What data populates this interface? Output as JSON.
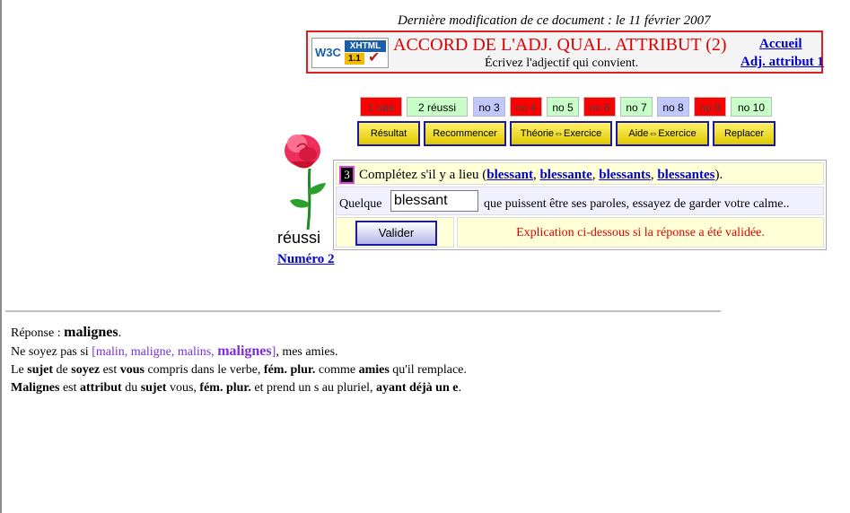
{
  "last_modified": "Dernière modification de ce document : le 11 février 2007",
  "header": {
    "badge": {
      "w3c": "W3C",
      "xhtml": "XHTML",
      "version": "1.1"
    },
    "title": "ACCORD DE L'ADJ. QUAL. ATTRIBUT (2)",
    "subtitle": "Écrivez l'adjectif qui convient.",
    "link_home": "Accueil",
    "link_prev": "Adj. attribut 1"
  },
  "number_buttons": [
    {
      "label": "1 raté",
      "state": "rate"
    },
    {
      "label": "2 réussi",
      "state": "reussi"
    },
    {
      "label": "no 3",
      "state": "cur"
    },
    {
      "label": "no 4",
      "state": "rate"
    },
    {
      "label": "no 5",
      "state": "todo"
    },
    {
      "label": "no 6",
      "state": "rate"
    },
    {
      "label": "no 7",
      "state": "todo"
    },
    {
      "label": "no 8",
      "state": "cur"
    },
    {
      "label": "no 9",
      "state": "rate"
    },
    {
      "label": "no 10",
      "state": "todo"
    }
  ],
  "action_buttons": {
    "resultat": "Résultat",
    "recommencer": "Recommencer",
    "theorie": "Théorie⇔Exercice",
    "aide": "Aide⇔Exercice",
    "replacer": "Replacer"
  },
  "status": {
    "label": "réussi",
    "numero": "Numéro 2"
  },
  "exercise": {
    "number": "3",
    "instruction_prefix": "Complétez s'il y a lieu (",
    "options": [
      "blessant",
      "blessante",
      "blessants",
      "blessantes"
    ],
    "sep": ", ",
    "instruction_suffix": ").",
    "sentence_start": "Quelque",
    "answer_value": "blessant",
    "sentence_end": "que puissent être ses paroles, essayez de garder votre calme..",
    "validate_label": "Valider",
    "explanation_note": "Explication ci-dessous si la réponse a été validée."
  },
  "explanation": {
    "line1_prefix": "Réponse : ",
    "line1_answer": "malignes",
    "line1_end": ".",
    "line2_prefix": "Ne soyez pas si ",
    "line2_opts": "[malin, maligne, malins, ",
    "line2_bold": "malignes",
    "line2_close": "]",
    "line2_end": ", mes amies.",
    "line3": {
      "a": "Le ",
      "b": "sujet",
      "c": " de ",
      "d": "soyez",
      "e": " est ",
      "f": "vous",
      "g": " compris dans le verbe, ",
      "h": "fém. plur.",
      "i": " comme ",
      "j": "amies",
      "k": " qu'il remplace."
    },
    "line4": {
      "a": "Malignes",
      "b": " est ",
      "c": "attribut",
      "d": " du ",
      "e": "sujet",
      "f": " vous, ",
      "g": "fém. plur.",
      "h": " et prend un s au pluriel, ",
      "i": "ayant déjà un e",
      "j": "."
    }
  }
}
